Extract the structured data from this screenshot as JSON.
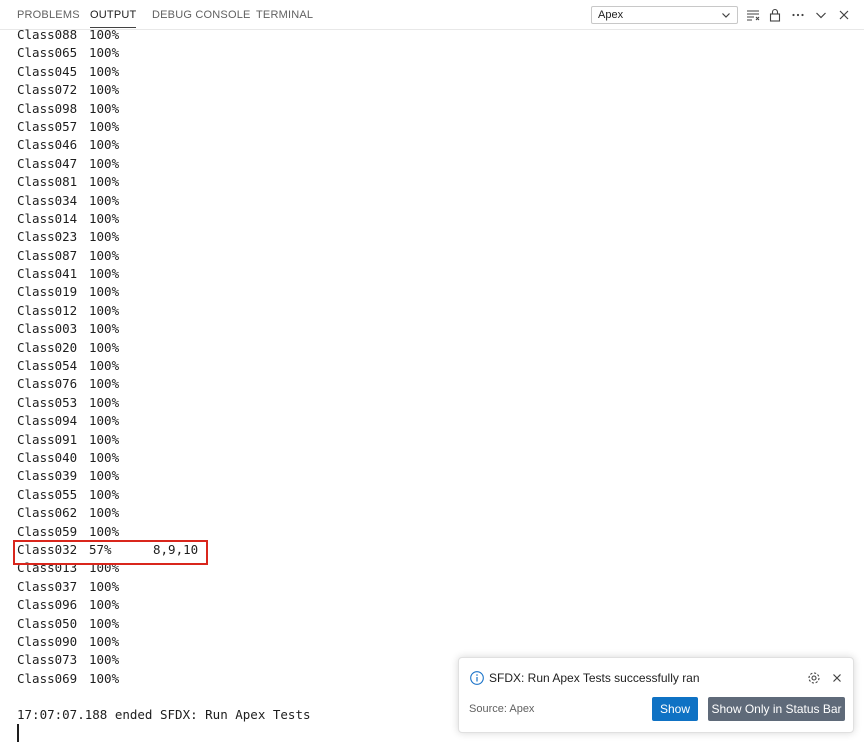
{
  "tabs": [
    {
      "label": "PROBLEMS"
    },
    {
      "label": "OUTPUT",
      "active": true
    },
    {
      "label": "DEBUG CONSOLE"
    },
    {
      "label": "TERMINAL"
    }
  ],
  "channel_select": {
    "value": "Apex"
  },
  "header_icons": [
    "filter-list-icon",
    "clear-output-icon",
    "lock-icon",
    "more-icon",
    "chevron-down-icon",
    "close-icon"
  ],
  "output_lines": [
    {
      "name": "Class088",
      "percent": "100%"
    },
    {
      "name": "Class065",
      "percent": "100%"
    },
    {
      "name": "Class045",
      "percent": "100%"
    },
    {
      "name": "Class072",
      "percent": "100%"
    },
    {
      "name": "Class098",
      "percent": "100%"
    },
    {
      "name": "Class057",
      "percent": "100%"
    },
    {
      "name": "Class046",
      "percent": "100%"
    },
    {
      "name": "Class047",
      "percent": "100%"
    },
    {
      "name": "Class081",
      "percent": "100%"
    },
    {
      "name": "Class034",
      "percent": "100%"
    },
    {
      "name": "Class014",
      "percent": "100%"
    },
    {
      "name": "Class023",
      "percent": "100%"
    },
    {
      "name": "Class087",
      "percent": "100%"
    },
    {
      "name": "Class041",
      "percent": "100%"
    },
    {
      "name": "Class019",
      "percent": "100%"
    },
    {
      "name": "Class012",
      "percent": "100%"
    },
    {
      "name": "Class003",
      "percent": "100%"
    },
    {
      "name": "Class020",
      "percent": "100%"
    },
    {
      "name": "Class054",
      "percent": "100%"
    },
    {
      "name": "Class076",
      "percent": "100%"
    },
    {
      "name": "Class053",
      "percent": "100%"
    },
    {
      "name": "Class094",
      "percent": "100%"
    },
    {
      "name": "Class091",
      "percent": "100%"
    },
    {
      "name": "Class040",
      "percent": "100%"
    },
    {
      "name": "Class039",
      "percent": "100%"
    },
    {
      "name": "Class055",
      "percent": "100%"
    },
    {
      "name": "Class062",
      "percent": "100%"
    },
    {
      "name": "Class059",
      "percent": "100%"
    },
    {
      "name": "Class032",
      "percent": "57%",
      "uncovered": "8,9,10",
      "highlighted": true
    },
    {
      "name": "Class013",
      "percent": "100%"
    },
    {
      "name": "Class037",
      "percent": "100%"
    },
    {
      "name": "Class096",
      "percent": "100%"
    },
    {
      "name": "Class050",
      "percent": "100%"
    },
    {
      "name": "Class090",
      "percent": "100%"
    },
    {
      "name": "Class073",
      "percent": "100%"
    },
    {
      "name": "Class069",
      "percent": "100%"
    }
  ],
  "ended_line": "17:07:07.188 ended SFDX: Run Apex Tests",
  "notification": {
    "message": "SFDX: Run Apex Tests successfully ran",
    "source": "Source: Apex",
    "show_label": "Show",
    "status_bar_label": "Show Only in Status Bar"
  },
  "colors": {
    "highlight_border": "#d9261c",
    "primary_button": "#0f72c4",
    "secondary_button": "#5f6a79",
    "info_icon": "#1a73c9"
  }
}
